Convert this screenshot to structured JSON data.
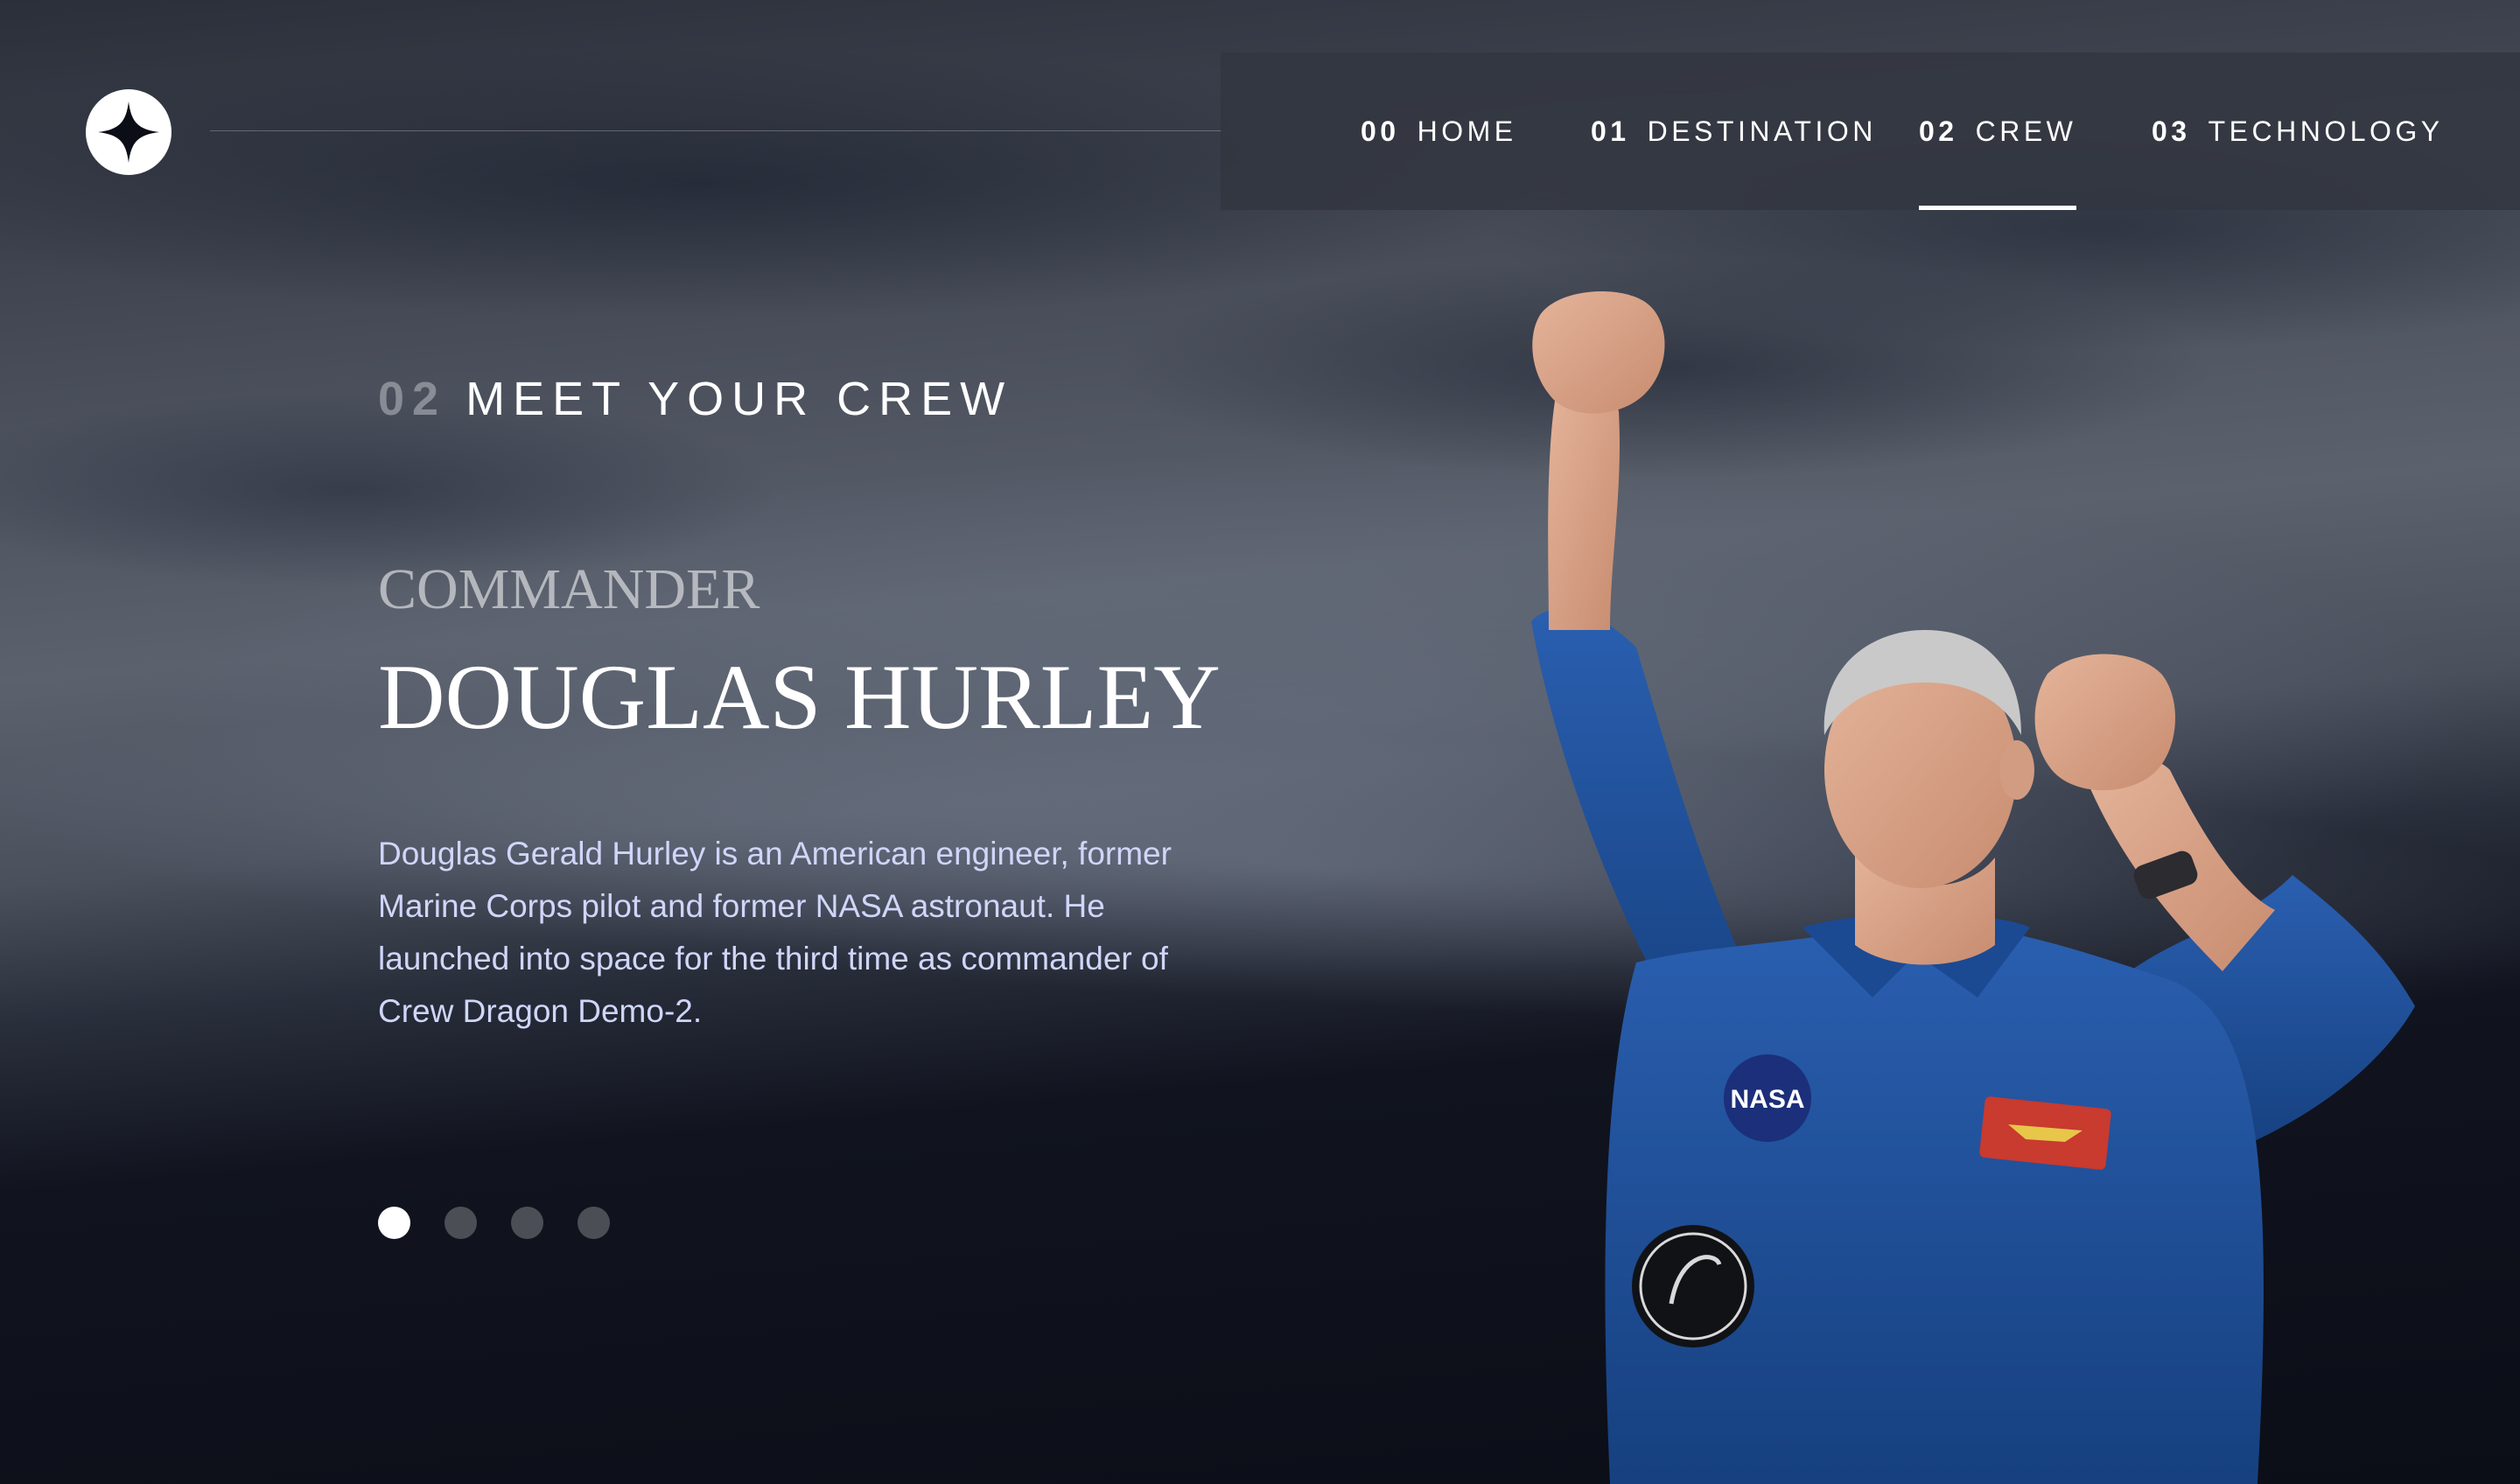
{
  "nav": {
    "items": [
      {
        "number": "00",
        "label": "HOME",
        "active": false
      },
      {
        "number": "01",
        "label": "DESTINATION",
        "active": false
      },
      {
        "number": "02",
        "label": "CREW",
        "active": true
      },
      {
        "number": "03",
        "label": "TECHNOLOGY",
        "active": false
      }
    ]
  },
  "eyebrow": {
    "number": "02",
    "text": "MEET YOUR CREW"
  },
  "crew": {
    "role": "COMMANDER",
    "name": "DOUGLAS HURLEY",
    "bio": "Douglas Gerald Hurley is an American engineer, former Marine Corps pilot and former NASA astronaut. He launched into space for the third time as commander of Crew Dragon Demo-2."
  },
  "carousel": {
    "count": 4,
    "active_index": 0
  },
  "icons": {
    "logo": "four-point-star-icon"
  },
  "colors": {
    "background": "#0b0d17",
    "text": "#ffffff",
    "body_text": "#d0d6f9",
    "suit_blue": "#1e4f9c"
  }
}
